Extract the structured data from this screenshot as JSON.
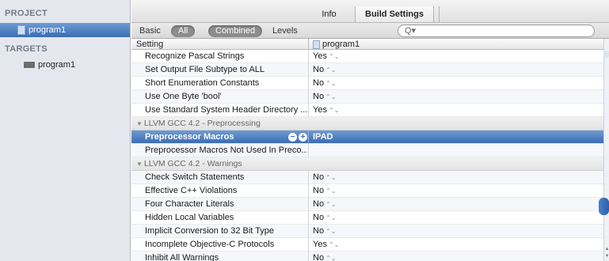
{
  "sidebar": {
    "project_header": "PROJECT",
    "project_item": "program1",
    "targets_header": "TARGETS",
    "target_item": "program1"
  },
  "tabs": {
    "info": "Info",
    "build_settings": "Build Settings"
  },
  "filter": {
    "basic": "Basic",
    "all": "All",
    "combined": "Combined",
    "levels": "Levels",
    "search_placeholder": "Q▾"
  },
  "table": {
    "col_setting": "Setting",
    "col_target": "program1",
    "rows": [
      {
        "name": "Recognize Pascal Strings",
        "value": "Yes",
        "stepper": "⌃⌄"
      },
      {
        "name": "Set Output File Subtype to ALL",
        "value": "No",
        "stepper": "⌃⌄"
      },
      {
        "name": "Short Enumeration Constants",
        "value": "No",
        "stepper": "⌃⌄"
      },
      {
        "name": "Use One Byte 'bool'",
        "value": "No",
        "stepper": "⌃⌄"
      },
      {
        "name": "Use Standard System Header Directory ...",
        "value": "Yes",
        "stepper": "⌃⌄"
      },
      {
        "group": "LLVM GCC 4.2 - Preprocessing"
      },
      {
        "name": "Preprocessor Macros",
        "value": "IPAD",
        "selected": true
      },
      {
        "name": "Preprocessor Macros Not Used In Preco...",
        "value": ""
      },
      {
        "group": "LLVM GCC 4.2 - Warnings"
      },
      {
        "name": "Check Switch Statements",
        "value": "No",
        "stepper": "⌃⌄"
      },
      {
        "name": "Effective C++ Violations",
        "value": "No",
        "stepper": "⌃⌄"
      },
      {
        "name": "Four Character Literals",
        "value": "No",
        "stepper": "⌃⌄"
      },
      {
        "name": "Hidden Local Variables",
        "value": "No",
        "stepper": "⌃⌄"
      },
      {
        "name": "Implicit Conversion to 32 Bit Type",
        "value": "No",
        "stepper": "⌃⌄"
      },
      {
        "name": "Incomplete Objective-C Protocols",
        "value": "Yes",
        "stepper": "⌃⌄"
      },
      {
        "name": "Inhibit All Warnings",
        "value": "No",
        "stepper": "⌃⌄"
      }
    ]
  },
  "colors": {
    "selection": "#3b6db4",
    "sidebar_bg": "#e4e8ee"
  }
}
